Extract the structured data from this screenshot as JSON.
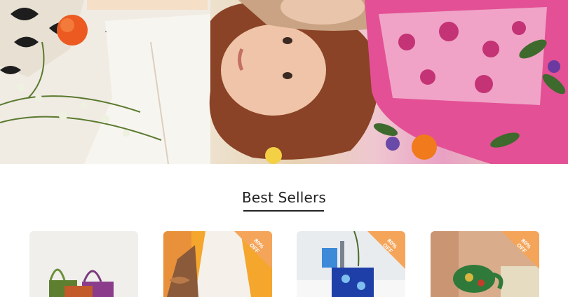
{
  "hero": {
    "image": "hero-banner-image"
  },
  "best_sellers": {
    "title": "Best Sellers",
    "products": [
      {
        "image": "tote-bags-product-image",
        "badge_value": "",
        "badge_label": ""
      },
      {
        "image": "dress-scarf-product-image",
        "badge_value": "80%",
        "badge_label": "OFF"
      },
      {
        "image": "towel-cup-product-image",
        "badge_value": "80%",
        "badge_label": "OFF"
      },
      {
        "image": "green-mug-product-image",
        "badge_value": "80%",
        "badge_label": "OFF"
      }
    ]
  },
  "colors": {
    "badge": "#f5a55a",
    "underline": "#222222"
  }
}
